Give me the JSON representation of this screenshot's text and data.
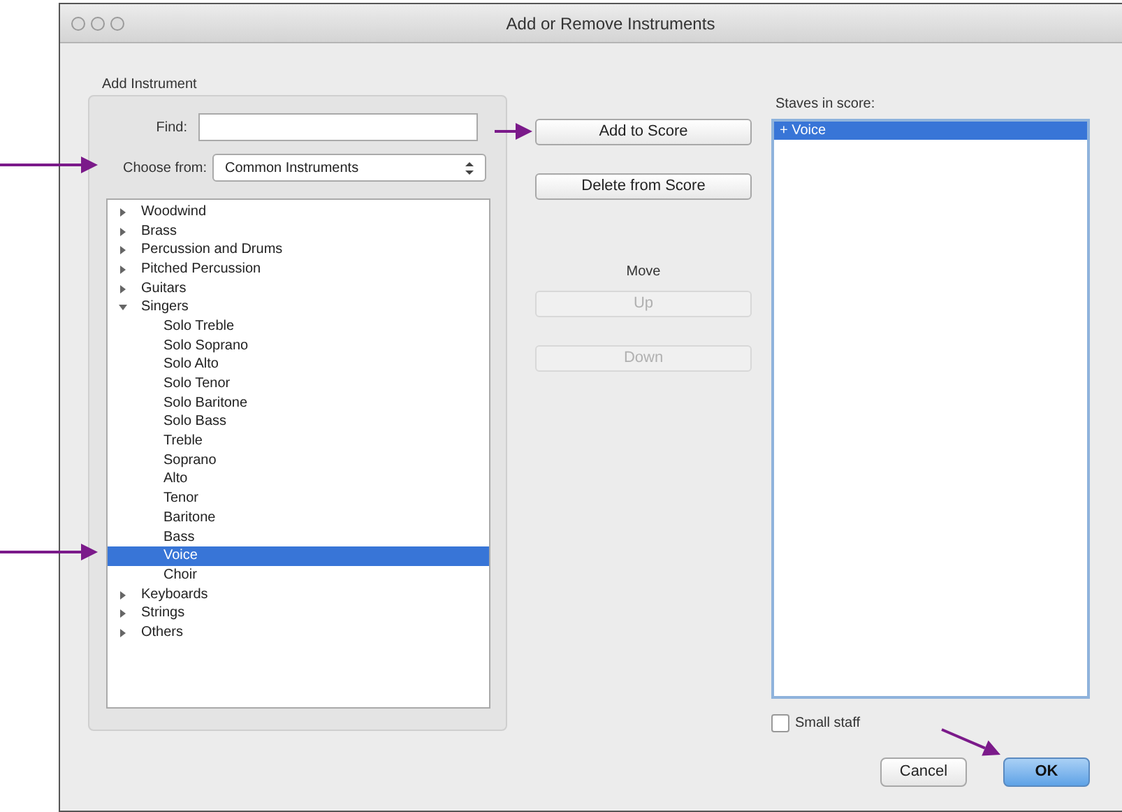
{
  "window": {
    "title": "Add or Remove Instruments"
  },
  "add_instrument": {
    "title": "Add Instrument",
    "find": {
      "label": "Find:"
    },
    "choose_from": {
      "label": "Choose from:",
      "value": "Common Instruments"
    },
    "tree": [
      {
        "label": "Woodwind",
        "expanded": false,
        "selected": false
      },
      {
        "label": "Brass",
        "expanded": false,
        "selected": false
      },
      {
        "label": "Percussion and Drums",
        "expanded": false,
        "selected": false
      },
      {
        "label": "Pitched Percussion",
        "expanded": false,
        "selected": false
      },
      {
        "label": "Guitars",
        "expanded": false,
        "selected": false
      },
      {
        "label": "Singers",
        "expanded": true,
        "selected": false,
        "children": [
          {
            "label": "Solo Treble",
            "selected": false
          },
          {
            "label": "Solo Soprano",
            "selected": false
          },
          {
            "label": "Solo Alto",
            "selected": false
          },
          {
            "label": "Solo Tenor",
            "selected": false
          },
          {
            "label": "Solo Baritone",
            "selected": false
          },
          {
            "label": "Solo Bass",
            "selected": false
          },
          {
            "label": "Treble",
            "selected": false
          },
          {
            "label": "Soprano",
            "selected": false
          },
          {
            "label": "Alto",
            "selected": false
          },
          {
            "label": "Tenor",
            "selected": false
          },
          {
            "label": "Baritone",
            "selected": false
          },
          {
            "label": "Bass",
            "selected": false
          },
          {
            "label": "Voice",
            "selected": true
          },
          {
            "label": "Choir",
            "selected": false
          }
        ]
      },
      {
        "label": "Keyboards",
        "expanded": false,
        "selected": false
      },
      {
        "label": "Strings",
        "expanded": false,
        "selected": false
      },
      {
        "label": "Others",
        "expanded": false,
        "selected": false
      }
    ]
  },
  "actions": {
    "add": {
      "label": "Add to Score",
      "disabled": false
    },
    "delete": {
      "label": "Delete from Score",
      "disabled": false
    },
    "move_label": "Move",
    "up": {
      "label": "Up",
      "disabled": true
    },
    "down": {
      "label": "Down",
      "disabled": true
    }
  },
  "staves": {
    "title": "Staves in score:",
    "items": [
      {
        "label": "+ Voice",
        "selected": true
      }
    ],
    "small_staff": {
      "label": "Small staff",
      "checked": false
    }
  },
  "buttons": [
    {
      "label": "Cancel",
      "default": false
    },
    {
      "label": "OK",
      "default": true
    }
  ]
}
